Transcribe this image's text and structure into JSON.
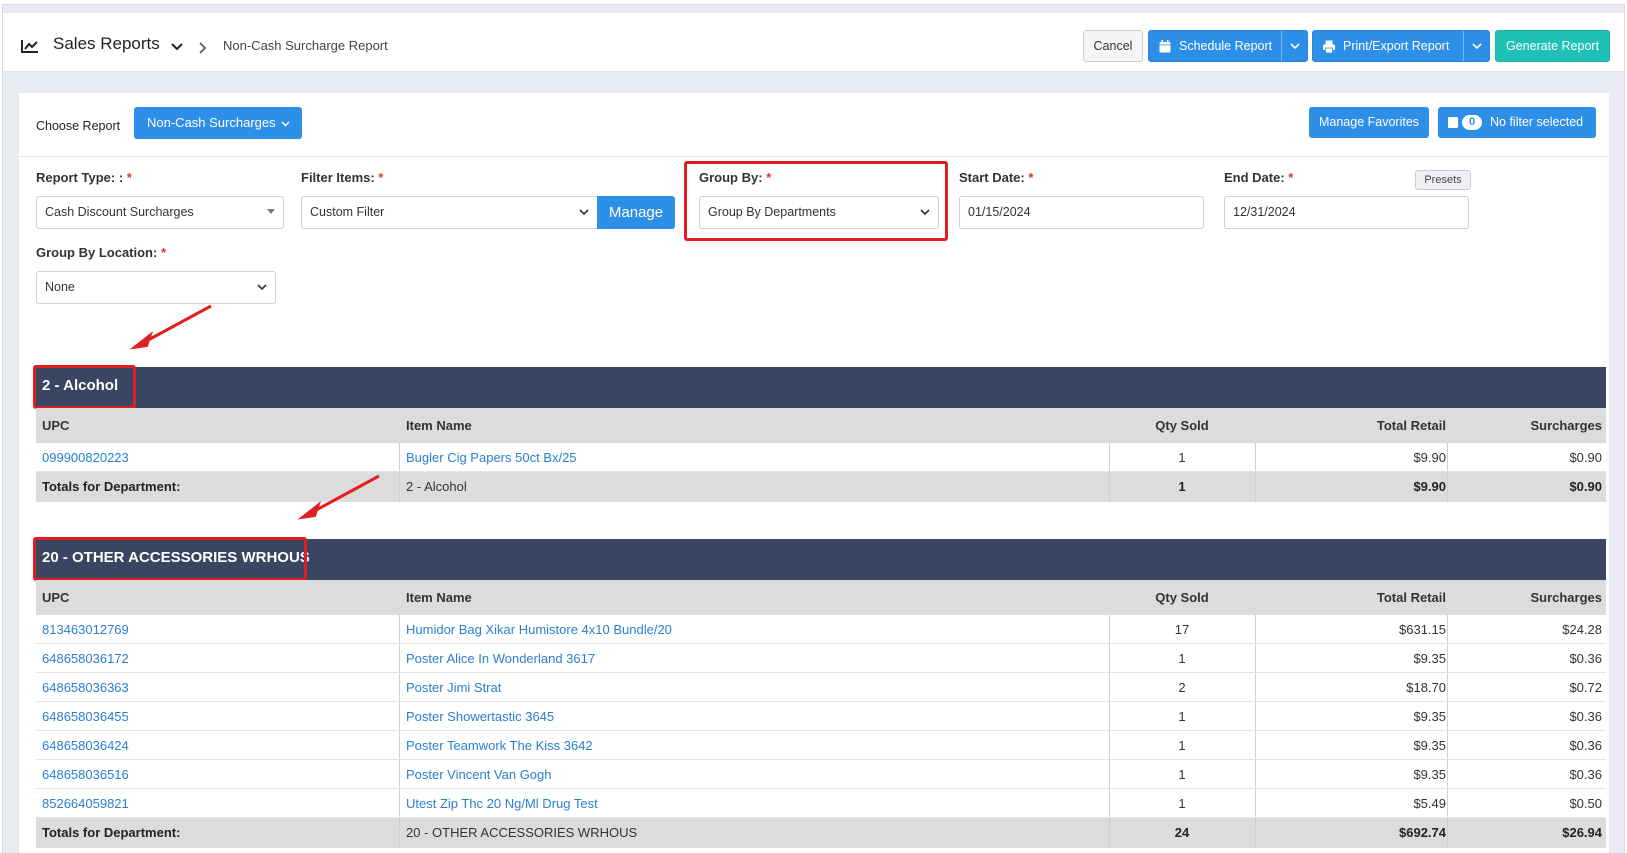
{
  "header": {
    "title": "Sales Reports",
    "breadcrumb": "Non-Cash Surcharge Report",
    "cancel": "Cancel",
    "schedule": "Schedule Report",
    "print_export": "Print/Export Report",
    "generate": "Generate Report"
  },
  "toolbar": {
    "choose_label": "Choose Report",
    "report_selected": "Non-Cash Surcharges",
    "manage_favorites": "Manage Favorites",
    "filter_count": "0",
    "filter_text": "No filter selected"
  },
  "form": {
    "report_type_label": "Report Type: :",
    "report_type_value": "Cash Discount Surcharges",
    "filter_items_label": "Filter Items:",
    "filter_items_value": "Custom Filter",
    "manage": "Manage",
    "group_by_label": "Group By:",
    "group_by_value": "Group By Departments",
    "start_date_label": "Start Date:",
    "start_date_value": "01/15/2024",
    "end_date_label": "End Date:",
    "end_date_value": "12/31/2024",
    "presets": "Presets",
    "group_by_location_label": "Group By Location:",
    "group_by_location_value": "None",
    "required_mark": "*"
  },
  "columns": {
    "upc": "UPC",
    "item_name": "Item Name",
    "qty_sold": "Qty Sold",
    "total_retail": "Total Retail",
    "surcharges": "Surcharges"
  },
  "departments": [
    {
      "name": "2 - Alcohol",
      "rows": [
        {
          "upc": "099900820223",
          "name": "Bugler Cig Papers 50ct Bx/25",
          "qty": "1",
          "retail": "$9.90",
          "surcharge": "$0.90"
        }
      ],
      "totals": {
        "label": "Totals for Department:",
        "name": "2 - Alcohol",
        "qty": "1",
        "retail": "$9.90",
        "surcharge": "$0.90"
      }
    },
    {
      "name": "20 - OTHER ACCESSORIES WRHOUS",
      "rows": [
        {
          "upc": "813463012769",
          "name": "Humidor Bag Xikar Humistore 4x10 Bundle/20",
          "qty": "17",
          "retail": "$631.15",
          "surcharge": "$24.28"
        },
        {
          "upc": "648658036172",
          "name": "Poster Alice In Wonderland 3617",
          "qty": "1",
          "retail": "$9.35",
          "surcharge": "$0.36"
        },
        {
          "upc": "648658036363",
          "name": "Poster Jimi Strat",
          "qty": "2",
          "retail": "$18.70",
          "surcharge": "$0.72"
        },
        {
          "upc": "648658036455",
          "name": "Poster Showertastic 3645",
          "qty": "1",
          "retail": "$9.35",
          "surcharge": "$0.36"
        },
        {
          "upc": "648658036424",
          "name": "Poster Teamwork The Kiss 3642",
          "qty": "1",
          "retail": "$9.35",
          "surcharge": "$0.36"
        },
        {
          "upc": "648658036516",
          "name": "Poster Vincent Van Gogh",
          "qty": "1",
          "retail": "$9.35",
          "surcharge": "$0.36"
        },
        {
          "upc": "852664059821",
          "name": "Utest Zip Thc 20 Ng/Ml Drug Test",
          "qty": "1",
          "retail": "$5.49",
          "surcharge": "$0.50"
        }
      ],
      "totals": {
        "label": "Totals for Department:",
        "name": "20 - OTHER ACCESSORIES WRHOUS",
        "qty": "24",
        "retail": "$692.74",
        "surcharge": "$26.94"
      }
    }
  ],
  "colors": {
    "primary": "#2e8fe8",
    "teal": "#1fc0b5",
    "dept_bar": "#3a4562",
    "annotation_red": "#e02020",
    "link": "#2a7fd0"
  }
}
